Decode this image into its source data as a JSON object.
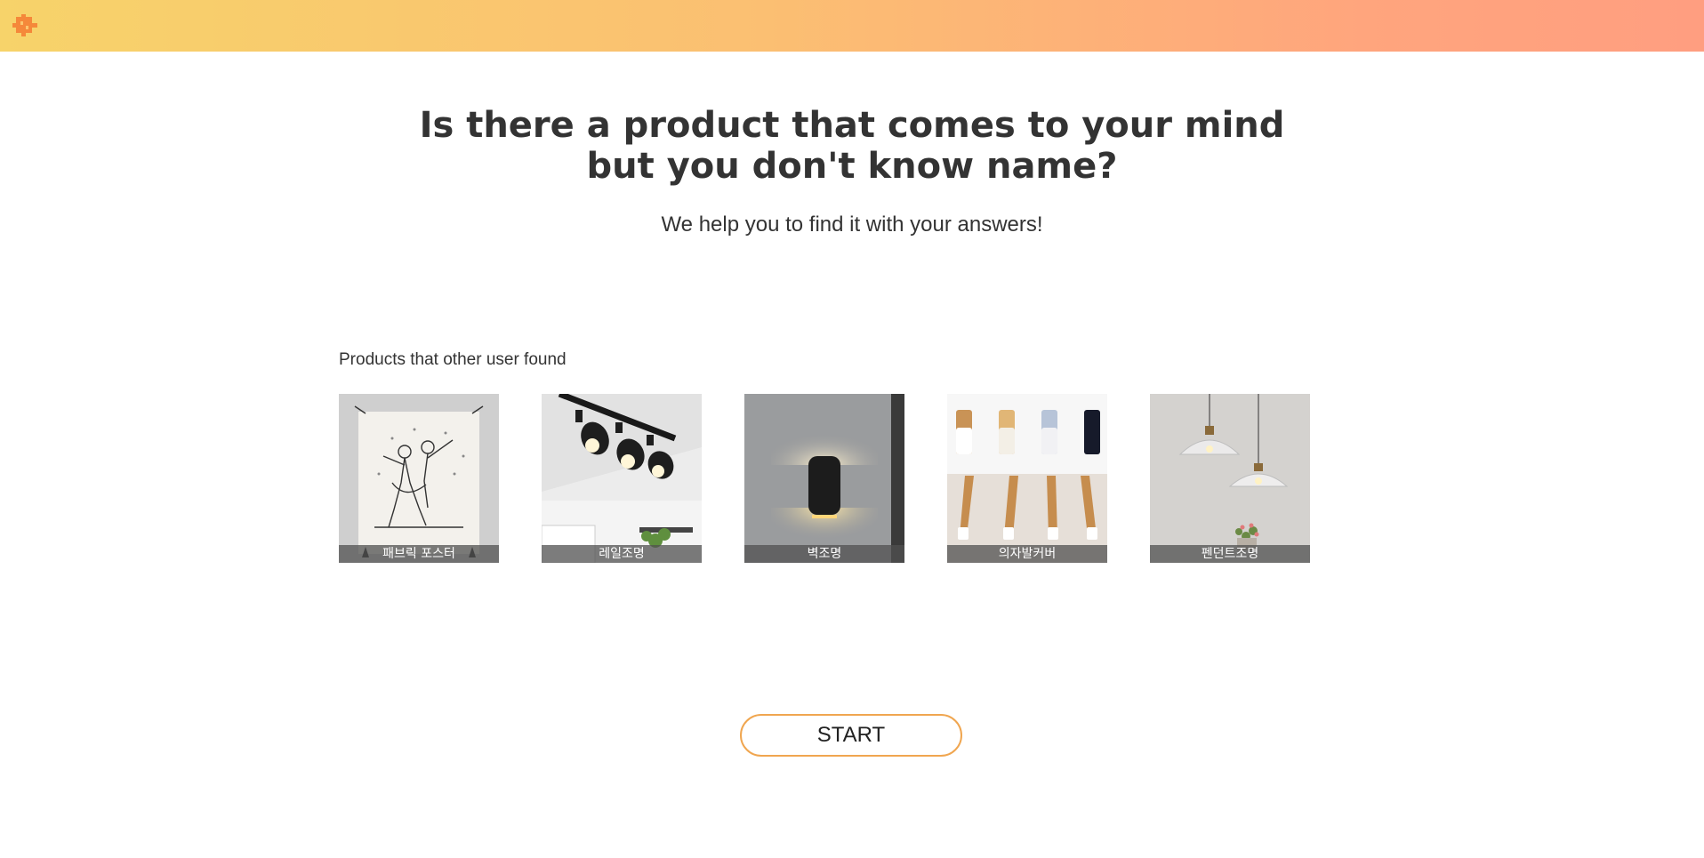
{
  "header": {
    "logo_icon": "puzzle-piece-icon",
    "gradient_start": "#f7d36a",
    "gradient_end": "#ff9e80"
  },
  "hero": {
    "title_line1": "Is there a product that comes to your mind",
    "title_line2": "but you don't know name?",
    "subtitle": "We help you to find it with your answers!"
  },
  "products_section": {
    "label": "Products that other user found",
    "items": [
      {
        "label": "패브릭 포스터",
        "image": "fabric-poster-image"
      },
      {
        "label": "레일조명",
        "image": "rail-lighting-image"
      },
      {
        "label": "벽조명",
        "image": "wall-lamp-image"
      },
      {
        "label": "의자발커버",
        "image": "chair-leg-cover-image"
      },
      {
        "label": "펜던트조명",
        "image": "pendant-lamp-image"
      }
    ]
  },
  "start_button": {
    "label": "START",
    "border_color": "#f0a650"
  }
}
